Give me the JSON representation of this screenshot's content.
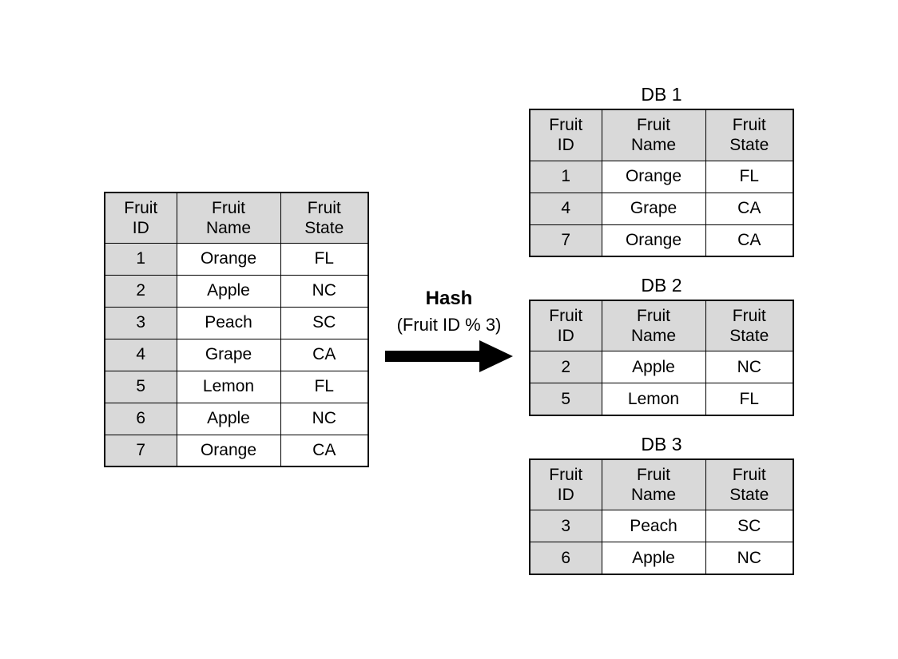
{
  "source_table": {
    "headers": [
      "Fruit\nID",
      "Fruit\nName",
      "Fruit\nState"
    ],
    "rows": [
      {
        "id": "1",
        "name": "Orange",
        "state": "FL"
      },
      {
        "id": "2",
        "name": "Apple",
        "state": "NC"
      },
      {
        "id": "3",
        "name": "Peach",
        "state": "SC"
      },
      {
        "id": "4",
        "name": "Grape",
        "state": "CA"
      },
      {
        "id": "5",
        "name": "Lemon",
        "state": "FL"
      },
      {
        "id": "6",
        "name": "Apple",
        "state": "NC"
      },
      {
        "id": "7",
        "name": "Orange",
        "state": "CA"
      }
    ]
  },
  "hash": {
    "label": "Hash",
    "formula": "(Fruit ID % 3)"
  },
  "partitions": [
    {
      "title": "DB 1",
      "headers": [
        "Fruit\nID",
        "Fruit\nName",
        "Fruit\nState"
      ],
      "rows": [
        {
          "id": "1",
          "name": "Orange",
          "state": "FL"
        },
        {
          "id": "4",
          "name": "Grape",
          "state": "CA"
        },
        {
          "id": "7",
          "name": "Orange",
          "state": "CA"
        }
      ]
    },
    {
      "title": "DB 2",
      "headers": [
        "Fruit\nID",
        "Fruit\nName",
        "Fruit\nState"
      ],
      "rows": [
        {
          "id": "2",
          "name": "Apple",
          "state": "NC"
        },
        {
          "id": "5",
          "name": "Lemon",
          "state": "FL"
        }
      ]
    },
    {
      "title": "DB 3",
      "headers": [
        "Fruit\nID",
        "Fruit\nName",
        "Fruit\nState"
      ],
      "rows": [
        {
          "id": "3",
          "name": "Peach",
          "state": "SC"
        },
        {
          "id": "6",
          "name": "Apple",
          "state": "NC"
        }
      ]
    }
  ]
}
